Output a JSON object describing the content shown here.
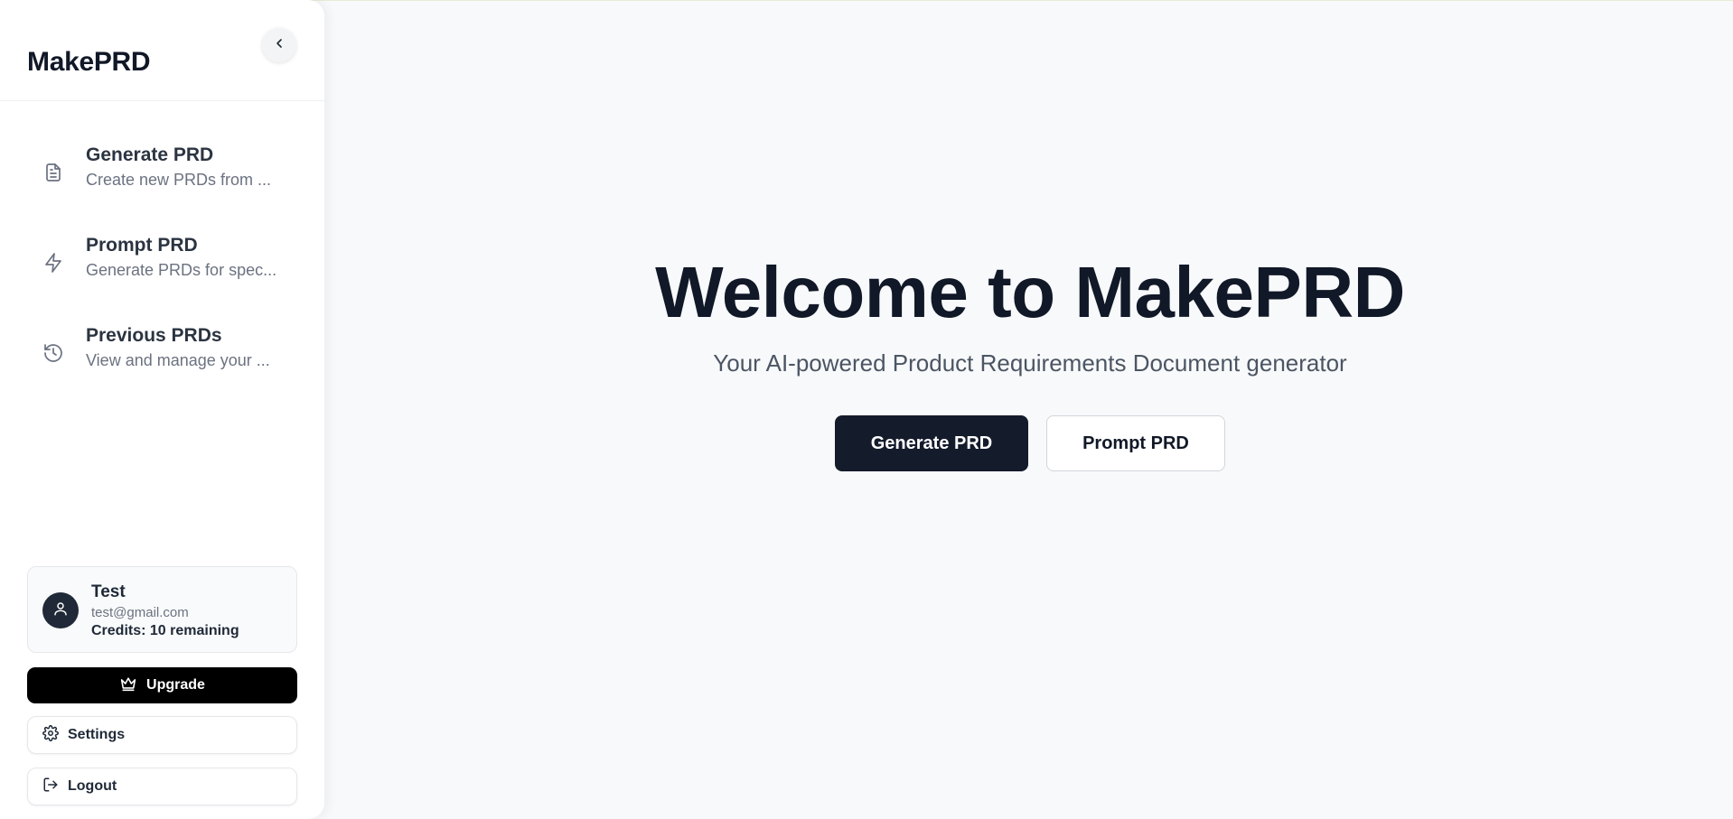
{
  "app": {
    "brand": "MakePRD"
  },
  "sidebar": {
    "nav": [
      {
        "title": "Generate PRD",
        "desc": "Create new PRDs from ...",
        "icon": "document-icon"
      },
      {
        "title": "Prompt PRD",
        "desc": "Generate PRDs for spec...",
        "icon": "lightning-icon"
      },
      {
        "title": "Previous PRDs",
        "desc": "View and manage your ...",
        "icon": "history-icon"
      }
    ],
    "user": {
      "name": "Test",
      "email": "test@gmail.com",
      "credits": "Credits: 10 remaining"
    },
    "upgrade_label": "Upgrade",
    "settings_label": "Settings",
    "logout_label": "Logout"
  },
  "main": {
    "title": "Welcome to MakePRD",
    "subtitle": "Your AI-powered Product Requirements Document generator",
    "primary_label": "Generate PRD",
    "secondary_label": "Prompt PRD"
  },
  "colors": {
    "primary_button": "#141b2b",
    "upgrade_button": "#000000",
    "page_background": "#f8f9fb"
  }
}
